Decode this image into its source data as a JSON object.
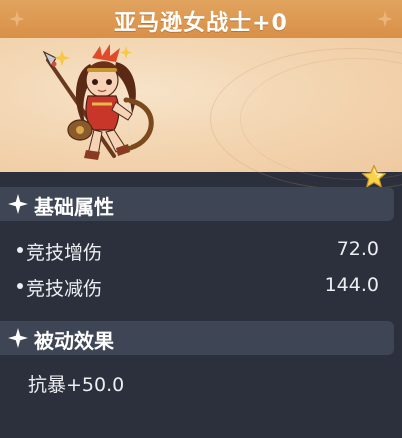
{
  "header": {
    "title": "亚马逊女战士+0"
  },
  "hero": {
    "avatar_icon": "amazon-warrior-portrait",
    "star_icon": "gold-star-icon"
  },
  "sections": {
    "basic": {
      "title": "基础属性",
      "stats": [
        {
          "name": "竞技增伤",
          "value": "72.0"
        },
        {
          "name": "竞技减伤",
          "value": "144.0"
        }
      ]
    },
    "passive": {
      "title": "被动效果",
      "effect": "抗暴+50.0"
    }
  },
  "colors": {
    "header": "#d98f47",
    "hero_bg": "#f3d6b2",
    "panel_bg": "#2b303c",
    "section_bg": "#3e4554",
    "text": "#eceef2"
  }
}
